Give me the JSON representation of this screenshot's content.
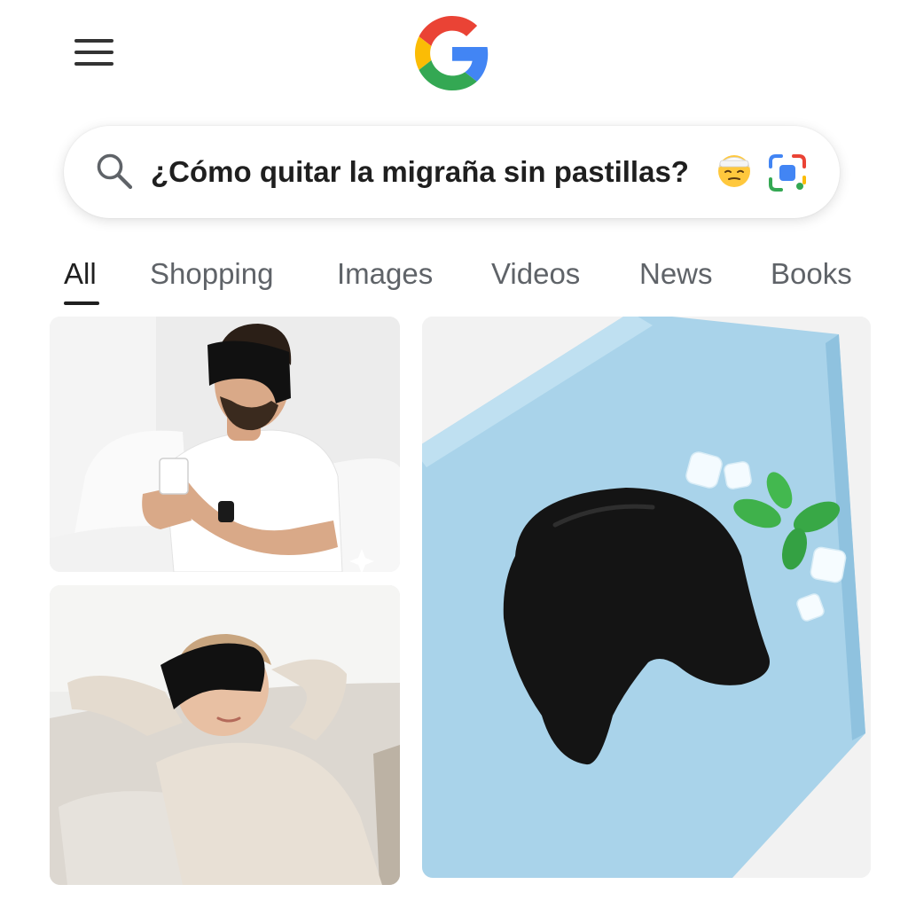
{
  "header": {
    "menu_icon": "hamburger-menu-icon",
    "logo": "google-g-logo",
    "logo_colors": {
      "red": "#EA4335",
      "yellow": "#FBBC05",
      "green": "#34A853",
      "blue": "#4285F4"
    }
  },
  "search": {
    "query": "¿Cómo quitar la migraña sin pastillas?",
    "emoji": "face-with-bandage-emoji",
    "icons": [
      "search-icon",
      "google-lens-icon"
    ]
  },
  "tabs": [
    {
      "label": "All",
      "active": true
    },
    {
      "label": "Shopping",
      "active": false
    },
    {
      "label": "Images",
      "active": false
    },
    {
      "label": "Videos",
      "active": false
    },
    {
      "label": "News",
      "active": false
    },
    {
      "label": "Books",
      "active": false
    }
  ],
  "results": {
    "images": [
      {
        "subject": "man-in-bed-with-black-eye-mask-holding-mug"
      },
      {
        "subject": "woman-on-sofa-with-black-eye-mask"
      },
      {
        "subject": "black-gel-head-mask-on-blue-towel-with-ice-and-mint"
      }
    ]
  },
  "colors": {
    "accent_text": "#1f1f1f",
    "inactive_tab": "#5f6368",
    "towel_blue": "#a9d3ea"
  }
}
